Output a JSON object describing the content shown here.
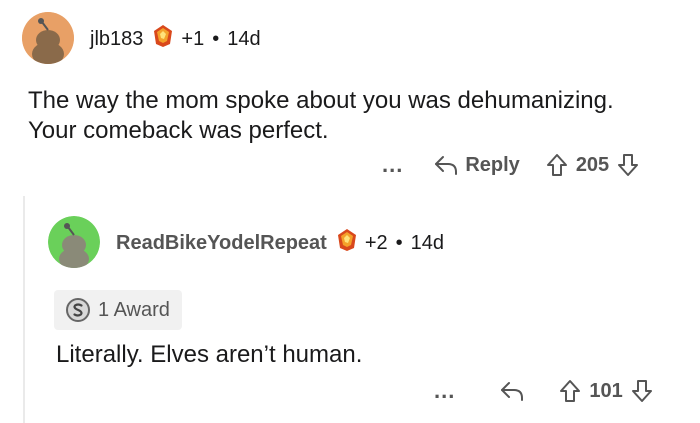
{
  "comment": {
    "username": "jlb183",
    "karma": "+1",
    "separator": "•",
    "age": "14d",
    "text_line1": "The way the mom spoke about you was dehumanizing.",
    "text_line2": "Your comeback was perfect.",
    "more": "...",
    "reply_label": "Reply",
    "score": "205",
    "avatar_color": "#e0924a"
  },
  "reply": {
    "username": "ReadBikeYodelRepeat",
    "karma": "+2",
    "separator": "•",
    "age": "14d",
    "award_label": "1 Award",
    "text": "Literally. Elves aren’t human.",
    "more": "...",
    "score": "101",
    "avatar_color": "#6ad05a"
  },
  "icons": {
    "flair": "fire-crystal-icon",
    "avatar": "snoo-avatar-icon",
    "reply": "reply-arrow-icon",
    "upvote": "upvote-arrow-icon",
    "downvote": "downvote-arrow-icon",
    "award": "silver-award-icon"
  }
}
